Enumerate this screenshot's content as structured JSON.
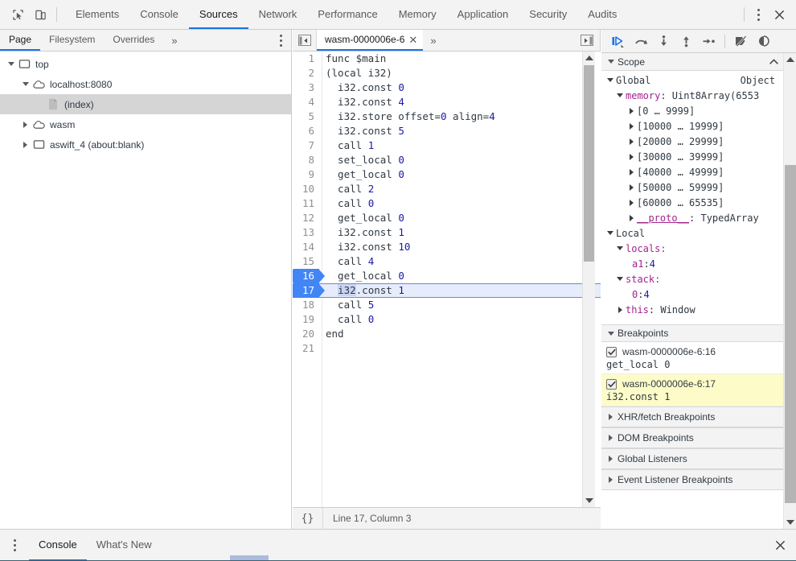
{
  "main_toolbar": {
    "icons": [
      {
        "name": "inspect-element-icon",
        "label": "Inspect element"
      },
      {
        "name": "device-toolbar-icon",
        "label": "Toggle device toolbar"
      }
    ],
    "tabs": [
      {
        "label": "Elements",
        "active": false
      },
      {
        "label": "Console",
        "active": false
      },
      {
        "label": "Sources",
        "active": true
      },
      {
        "label": "Network",
        "active": false
      },
      {
        "label": "Performance",
        "active": false
      },
      {
        "label": "Memory",
        "active": false
      },
      {
        "label": "Application",
        "active": false
      },
      {
        "label": "Security",
        "active": false
      },
      {
        "label": "Audits",
        "active": false
      }
    ],
    "more_label": "⋮",
    "close_label": "✕",
    "accent_color": "#1a73e8"
  },
  "navigator": {
    "tabs": [
      {
        "label": "Page",
        "active": true
      },
      {
        "label": "Filesystem",
        "active": false
      },
      {
        "label": "Overrides",
        "active": false
      }
    ],
    "more_label": "»",
    "menu_label": "⋮",
    "tree": [
      {
        "label": "top",
        "icon": "frame-icon",
        "twisty": "open",
        "indent": 8,
        "selected": false
      },
      {
        "label": "localhost:8080",
        "icon": "cloud-icon",
        "twisty": "open",
        "indent": 26,
        "selected": false
      },
      {
        "label": "(index)",
        "icon": "document-icon",
        "twisty": "none",
        "indent": 44,
        "selected": true
      },
      {
        "label": "wasm",
        "icon": "cloud-icon",
        "twisty": "closed",
        "indent": 26,
        "selected": false
      },
      {
        "label": "aswift_4 (about:blank)",
        "icon": "frame-icon",
        "twisty": "closed",
        "indent": 26,
        "selected": false
      }
    ]
  },
  "editor": {
    "nav_back_label": "◀",
    "nav_forward_label": "▶",
    "tab": {
      "title": "wasm-0000006e-6",
      "close_label": "✕"
    },
    "more_label": "»",
    "lines": [
      {
        "n": "1",
        "text": "func $main",
        "bp": false,
        "exec": false
      },
      {
        "n": "2",
        "text": "(local i32)",
        "bp": false,
        "exec": false
      },
      {
        "n": "3",
        "text": "  i32.const 0",
        "bp": false,
        "exec": false
      },
      {
        "n": "4",
        "text": "  i32.const 4",
        "bp": false,
        "exec": false
      },
      {
        "n": "5",
        "text": "  i32.store offset=0 align=4",
        "bp": false,
        "exec": false
      },
      {
        "n": "6",
        "text": "  i32.const 5",
        "bp": false,
        "exec": false
      },
      {
        "n": "7",
        "text": "  call 1",
        "bp": false,
        "exec": false
      },
      {
        "n": "8",
        "text": "  set_local 0",
        "bp": false,
        "exec": false
      },
      {
        "n": "9",
        "text": "  get_local 0",
        "bp": false,
        "exec": false
      },
      {
        "n": "10",
        "text": "  call 2",
        "bp": false,
        "exec": false
      },
      {
        "n": "11",
        "text": "  call 0",
        "bp": false,
        "exec": false
      },
      {
        "n": "12",
        "text": "  get_local 0",
        "bp": false,
        "exec": false
      },
      {
        "n": "13",
        "text": "  i32.const 1",
        "bp": false,
        "exec": false
      },
      {
        "n": "14",
        "text": "  i32.const 10",
        "bp": false,
        "exec": false
      },
      {
        "n": "15",
        "text": "  call 4",
        "bp": false,
        "exec": false
      },
      {
        "n": "16",
        "text": "  get_local 0",
        "bp": true,
        "exec": false
      },
      {
        "n": "17",
        "text": "  i32.const 1",
        "bp": true,
        "exec": true
      },
      {
        "n": "18",
        "text": "  call 5",
        "bp": false,
        "exec": false
      },
      {
        "n": "19",
        "text": "  call 0",
        "bp": false,
        "exec": false
      },
      {
        "n": "20",
        "text": "end",
        "bp": false,
        "exec": false
      },
      {
        "n": "21",
        "text": "",
        "bp": false,
        "exec": false
      }
    ],
    "status": {
      "format_label": "{}",
      "position": "Line 17, Column 3"
    }
  },
  "debugger": {
    "toolbar": [
      {
        "name": "resume-button",
        "label": "Resume script execution"
      },
      {
        "name": "step-over-button",
        "label": "Step over next function call"
      },
      {
        "name": "step-into-button",
        "label": "Step into next function call"
      },
      {
        "name": "step-out-button",
        "label": "Step out of current function"
      },
      {
        "name": "step-button",
        "label": "Step"
      },
      {
        "name": "deactivate-breakpoints-button",
        "label": "Deactivate breakpoints"
      },
      {
        "name": "pause-on-exceptions-button",
        "label": "Pause on exceptions"
      }
    ],
    "scope": {
      "title": "Scope",
      "collapse_label": "▲",
      "rows": [
        {
          "indent": 6,
          "twisty": "open",
          "name": "Global",
          "kind": "name",
          "right": "Object"
        },
        {
          "indent": 18,
          "twisty": "open",
          "name": "memory",
          "kind": "prop",
          "value": ": Uint8Array(6553"
        },
        {
          "indent": 32,
          "twisty": "closed",
          "name": "[0 … 9999]",
          "kind": "name",
          "value": ""
        },
        {
          "indent": 32,
          "twisty": "closed",
          "name": "[10000 … 19999]",
          "kind": "name",
          "value": ""
        },
        {
          "indent": 32,
          "twisty": "closed",
          "name": "[20000 … 29999]",
          "kind": "name",
          "value": ""
        },
        {
          "indent": 32,
          "twisty": "closed",
          "name": "[30000 … 39999]",
          "kind": "name",
          "value": ""
        },
        {
          "indent": 32,
          "twisty": "closed",
          "name": "[40000 … 49999]",
          "kind": "name",
          "value": ""
        },
        {
          "indent": 32,
          "twisty": "closed",
          "name": "[50000 … 59999]",
          "kind": "name",
          "value": ""
        },
        {
          "indent": 32,
          "twisty": "closed",
          "name": "[60000 … 65535]",
          "kind": "name",
          "value": ""
        },
        {
          "indent": 32,
          "twisty": "closed",
          "name": "__proto__",
          "kind": "proto",
          "value": ": TypedArray"
        },
        {
          "indent": 6,
          "twisty": "open",
          "name": "Local",
          "kind": "name",
          "value": ""
        },
        {
          "indent": 18,
          "twisty": "open",
          "name": "locals",
          "kind": "prop",
          "value": ":"
        },
        {
          "indent": 38,
          "twisty": "none",
          "name": "a1",
          "kind": "prop",
          "value": ": ",
          "num": "4"
        },
        {
          "indent": 18,
          "twisty": "open",
          "name": "stack",
          "kind": "prop",
          "value": ":"
        },
        {
          "indent": 38,
          "twisty": "none",
          "name": "0",
          "kind": "prop",
          "value": ": ",
          "num": "4"
        },
        {
          "indent": 18,
          "twisty": "closed",
          "name": "this",
          "kind": "prop",
          "value": ": Window"
        }
      ]
    },
    "breakpoints": {
      "title": "Breakpoints",
      "items": [
        {
          "label": "wasm-0000006e-6:16",
          "snippet": "get_local 0",
          "checked": true,
          "active": false
        },
        {
          "label": "wasm-0000006e-6:17",
          "snippet": "i32.const 1",
          "checked": true,
          "active": true
        }
      ]
    },
    "sections": [
      {
        "title": "XHR/fetch Breakpoints"
      },
      {
        "title": "DOM Breakpoints"
      },
      {
        "title": "Global Listeners"
      },
      {
        "title": "Event Listener Breakpoints"
      }
    ],
    "scroll_down_label": "▼",
    "highlight_color": "#fdfcc8"
  },
  "drawer": {
    "menu_label": "⋮",
    "tabs": [
      {
        "label": "Console",
        "active": true
      },
      {
        "label": "What's New",
        "active": false
      }
    ],
    "close_label": "✕"
  }
}
